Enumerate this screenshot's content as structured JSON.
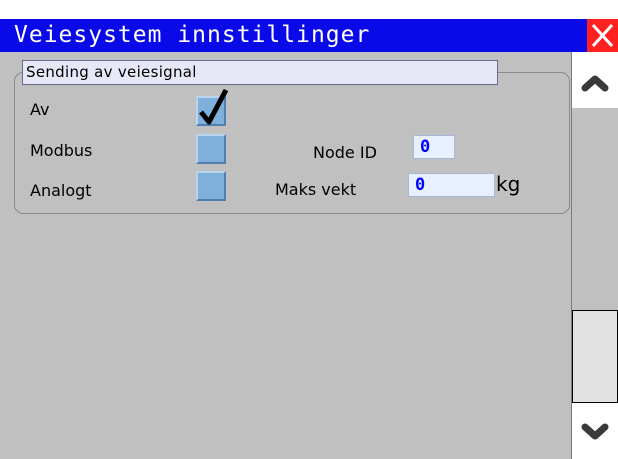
{
  "window": {
    "title": "Veiesystem innstillinger",
    "close_icon": "close-x-icon",
    "accent_color": "#0a0ae8",
    "close_color": "#ff2020"
  },
  "group": {
    "title": "Sending av veiesignal"
  },
  "options": [
    {
      "label": "Av",
      "checked": true
    },
    {
      "label": "Modbus",
      "checked": false
    },
    {
      "label": "Analogt",
      "checked": false
    }
  ],
  "fields": {
    "node_id": {
      "label": "Node ID",
      "value": "0"
    },
    "max_weight": {
      "label": "Maks vekt",
      "value": "0",
      "unit": "kg"
    }
  },
  "scrollbar": {
    "up_icon": "chevron-up-icon",
    "down_icon": "chevron-down-icon"
  }
}
